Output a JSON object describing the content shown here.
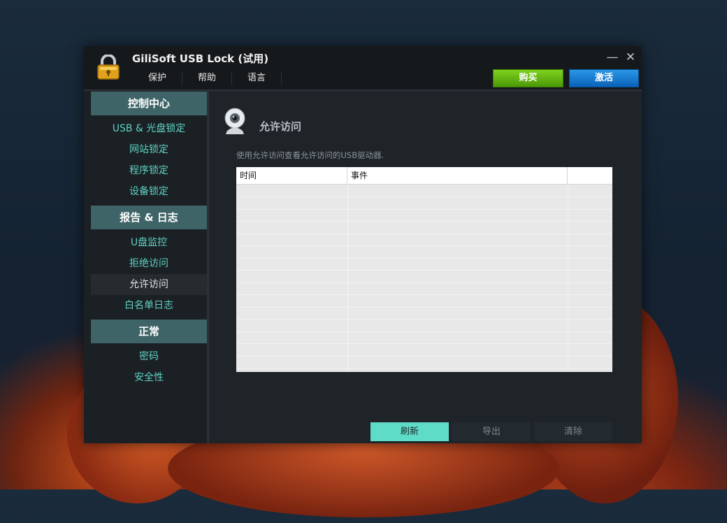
{
  "app": {
    "title": "GiliSoft USB Lock (试用)",
    "menu": [
      "保护",
      "帮助",
      "语言"
    ],
    "minimize_symbol": "—",
    "close_symbol": "✕",
    "buy_label": "购买",
    "activate_label": "激活"
  },
  "sidebar": {
    "sections": [
      {
        "header": "控制中心",
        "items": [
          "USB & 光盘锁定",
          "网站锁定",
          "程序锁定",
          "设备锁定"
        ]
      },
      {
        "header": "报告 & 日志",
        "items": [
          "U盘监控",
          "拒绝访问",
          "允许访问",
          "白名单日志"
        ]
      },
      {
        "header": "正常",
        "items": [
          "密码",
          "安全性"
        ]
      }
    ],
    "active_item": "允许访问"
  },
  "content": {
    "title": "允许访问",
    "description": "使用允许访问查看允许访问的USB驱动器.",
    "table": {
      "columns": [
        "时间",
        "事件",
        ""
      ],
      "rows": []
    },
    "buttons": {
      "refresh": "刷新",
      "export": "导出",
      "clear": "清除"
    }
  },
  "colors": {
    "accent": "#5fdcc8",
    "section_header": "#3e6468",
    "buy": "#5fb812",
    "activate": "#1a7fd4",
    "window_bg": "#1f2429"
  },
  "icons": {
    "logo": "padlock-icon",
    "section": "webcam-icon",
    "minimize": "minimize-icon",
    "close": "close-icon"
  }
}
